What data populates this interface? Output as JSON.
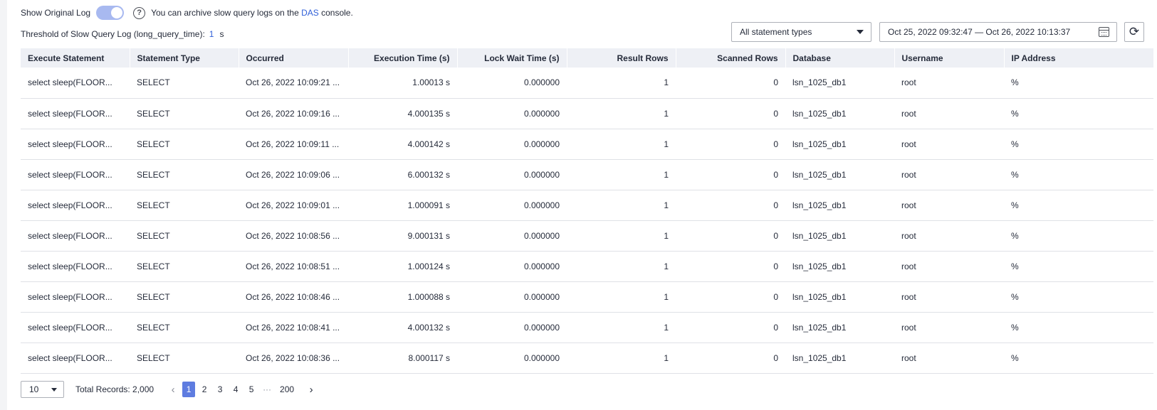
{
  "toolbar": {
    "show_original_log_label": "Show Original Log",
    "show_original_log_on": true,
    "help_glyph": "?",
    "tip_prefix": "You can archive slow query logs on the ",
    "tip_link": "DAS",
    "tip_suffix": " console.",
    "threshold_label": "Threshold of Slow Query Log (long_query_time):",
    "threshold_value": "1",
    "threshold_unit": "s",
    "statement_type_value": "All statement types",
    "date_range_value": "Oct 25, 2022 09:32:47 — Oct 26, 2022 10:13:37",
    "refresh_glyph": "⟳"
  },
  "table": {
    "columns": [
      "Execute Statement",
      "Statement Type",
      "Occurred",
      "Execution Time (s)",
      "Lock Wait Time (s)",
      "Result Rows",
      "Scanned Rows",
      "Database",
      "Username",
      "IP Address"
    ],
    "rows": [
      [
        "select sleep(FLOOR...",
        "SELECT",
        "Oct 26, 2022 10:09:21 ...",
        "1.00013 s",
        "0.000000",
        "1",
        "0",
        "lsn_1025_db1",
        "root",
        "%"
      ],
      [
        "select sleep(FLOOR...",
        "SELECT",
        "Oct 26, 2022 10:09:16 ...",
        "4.000135 s",
        "0.000000",
        "1",
        "0",
        "lsn_1025_db1",
        "root",
        "%"
      ],
      [
        "select sleep(FLOOR...",
        "SELECT",
        "Oct 26, 2022 10:09:11 ...",
        "4.000142 s",
        "0.000000",
        "1",
        "0",
        "lsn_1025_db1",
        "root",
        "%"
      ],
      [
        "select sleep(FLOOR...",
        "SELECT",
        "Oct 26, 2022 10:09:06 ...",
        "6.000132 s",
        "0.000000",
        "1",
        "0",
        "lsn_1025_db1",
        "root",
        "%"
      ],
      [
        "select sleep(FLOOR...",
        "SELECT",
        "Oct 26, 2022 10:09:01 ...",
        "1.000091 s",
        "0.000000",
        "1",
        "0",
        "lsn_1025_db1",
        "root",
        "%"
      ],
      [
        "select sleep(FLOOR...",
        "SELECT",
        "Oct 26, 2022 10:08:56 ...",
        "9.000131 s",
        "0.000000",
        "1",
        "0",
        "lsn_1025_db1",
        "root",
        "%"
      ],
      [
        "select sleep(FLOOR...",
        "SELECT",
        "Oct 26, 2022 10:08:51 ...",
        "1.000124 s",
        "0.000000",
        "1",
        "0",
        "lsn_1025_db1",
        "root",
        "%"
      ],
      [
        "select sleep(FLOOR...",
        "SELECT",
        "Oct 26, 2022 10:08:46 ...",
        "1.000088 s",
        "0.000000",
        "1",
        "0",
        "lsn_1025_db1",
        "root",
        "%"
      ],
      [
        "select sleep(FLOOR...",
        "SELECT",
        "Oct 26, 2022 10:08:41 ...",
        "4.000132 s",
        "0.000000",
        "1",
        "0",
        "lsn_1025_db1",
        "root",
        "%"
      ],
      [
        "select sleep(FLOOR...",
        "SELECT",
        "Oct 26, 2022 10:08:36 ...",
        "8.000117 s",
        "0.000000",
        "1",
        "0",
        "lsn_1025_db1",
        "root",
        "%"
      ]
    ]
  },
  "pagination": {
    "page_size": "10",
    "total_records": "Total Records: 2,000",
    "prev_glyph": "‹",
    "next_glyph": "›",
    "pages": [
      "1",
      "2",
      "3",
      "4",
      "5",
      "···",
      "200"
    ],
    "current_page": "1"
  },
  "colors": {
    "accent": "#5e7ce0",
    "link": "#2f5fd8",
    "toggle_on": "#a8b9f0",
    "header_bg": "#eef0f5"
  }
}
